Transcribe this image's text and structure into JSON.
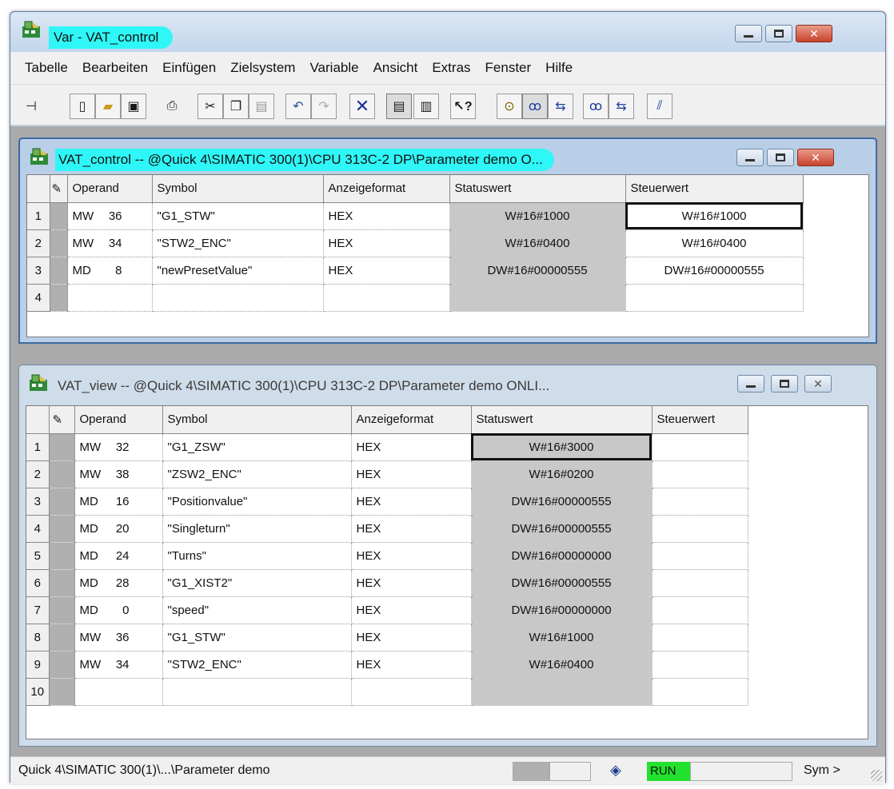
{
  "window": {
    "title": "Var - VAT_control"
  },
  "menu": [
    "Tabelle",
    "Bearbeiten",
    "Einfügen",
    "Zielsystem",
    "Variable",
    "Ansicht",
    "Extras",
    "Fenster",
    "Hilfe"
  ],
  "toolbar": {
    "icons": [
      "pin-icon",
      "new-icon",
      "open-icon",
      "save-icon",
      "print-icon",
      "cut-icon",
      "copy-icon",
      "paste-icon",
      "undo-icon",
      "redo-icon",
      "delete-icon",
      "insert-row-icon",
      "monitor-variable-icon",
      "help-icon",
      "monitor-icon",
      "trigger-icon",
      "modify-icon",
      "monitor-trigger-icon",
      "modify-trigger-icon",
      "force-icon"
    ]
  },
  "columns": [
    "Operand",
    "Symbol",
    "Anzeigeformat",
    "Statuswert",
    "Steuerwert"
  ],
  "vat_control": {
    "title": "VAT_control -- @Quick 4\\SIMATIC 300(1)\\CPU 313C-2 DP\\Parameter demo  O...",
    "rows": [
      {
        "n": "1",
        "op1": "MW",
        "op2": "36",
        "symbol": "\"G1_STW\"",
        "format": "HEX",
        "status": "W#16#1000",
        "control": "W#16#1000"
      },
      {
        "n": "2",
        "op1": "MW",
        "op2": "34",
        "symbol": "\"STW2_ENC\"",
        "format": "HEX",
        "status": "W#16#0400",
        "control": "W#16#0400"
      },
      {
        "n": "3",
        "op1": "MD",
        "op2": "8",
        "symbol": "\"newPresetValue\"",
        "format": "HEX",
        "status": "DW#16#00000555",
        "control": "DW#16#00000555"
      },
      {
        "n": "4",
        "op1": "",
        "op2": "",
        "symbol": "",
        "format": "",
        "status": "",
        "control": ""
      }
    ]
  },
  "vat_view": {
    "title": "VAT_view -- @Quick 4\\SIMATIC 300(1)\\CPU 313C-2 DP\\Parameter demo  ONLI...",
    "rows": [
      {
        "n": "1",
        "op1": "MW",
        "op2": "32",
        "symbol": "\"G1_ZSW\"",
        "format": "HEX",
        "status": "W#16#3000",
        "control": ""
      },
      {
        "n": "2",
        "op1": "MW",
        "op2": "38",
        "symbol": "\"ZSW2_ENC\"",
        "format": "HEX",
        "status": "W#16#0200",
        "control": ""
      },
      {
        "n": "3",
        "op1": "MD",
        "op2": "16",
        "symbol": "\"Positionvalue\"",
        "format": "HEX",
        "status": "DW#16#00000555",
        "control": ""
      },
      {
        "n": "4",
        "op1": "MD",
        "op2": "20",
        "symbol": "\"Singleturn\"",
        "format": "HEX",
        "status": "DW#16#00000555",
        "control": ""
      },
      {
        "n": "5",
        "op1": "MD",
        "op2": "24",
        "symbol": "\"Turns\"",
        "format": "HEX",
        "status": "DW#16#00000000",
        "control": ""
      },
      {
        "n": "6",
        "op1": "MD",
        "op2": "28",
        "symbol": "\"G1_XIST2\"",
        "format": "HEX",
        "status": "DW#16#00000555",
        "control": ""
      },
      {
        "n": "7",
        "op1": "MD",
        "op2": "0",
        "symbol": "\"speed\"",
        "format": "HEX",
        "status": "DW#16#00000000",
        "control": ""
      },
      {
        "n": "8",
        "op1": "MW",
        "op2": "36",
        "symbol": "\"G1_STW\"",
        "format": "HEX",
        "status": "W#16#1000",
        "control": ""
      },
      {
        "n": "9",
        "op1": "MW",
        "op2": "34",
        "symbol": "\"STW2_ENC\"",
        "format": "HEX",
        "status": "W#16#0400",
        "control": ""
      },
      {
        "n": "10",
        "op1": "",
        "op2": "",
        "symbol": "",
        "format": "",
        "status": "",
        "control": ""
      }
    ]
  },
  "statusbar": {
    "path": "Quick 4\\SIMATIC 300(1)\\...\\Parameter demo",
    "mode": "RUN",
    "sym": "Sym >"
  },
  "colors": {
    "title_highlight": "#2ff7f7",
    "status_cell": "#c8c8c8",
    "run_indicator": "#22e22e"
  }
}
